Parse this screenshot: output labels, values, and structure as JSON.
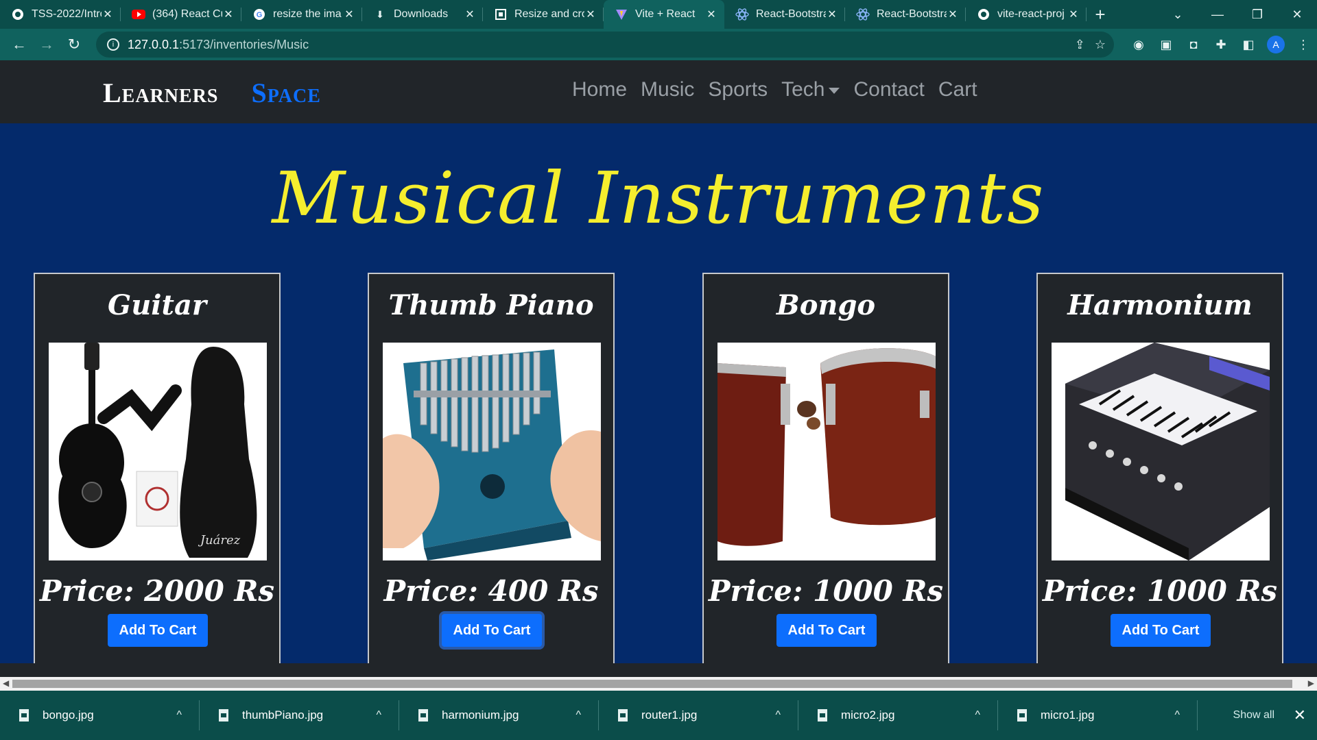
{
  "browser": {
    "tabs": [
      {
        "title": "TSS-2022/Intro",
        "icon": "github-icon"
      },
      {
        "title": "(364) React Cu",
        "icon": "youtube-icon"
      },
      {
        "title": "resize the ima",
        "icon": "google-icon"
      },
      {
        "title": "Downloads",
        "icon": "download-icon"
      },
      {
        "title": "Resize and cro",
        "icon": "crop-icon"
      },
      {
        "title": "Vite + React",
        "icon": "vite-icon",
        "active": true
      },
      {
        "title": "React-Bootstra",
        "icon": "react-icon"
      },
      {
        "title": "React-Bootstra",
        "icon": "react-icon"
      },
      {
        "title": "vite-react-proj",
        "icon": "github-icon"
      }
    ],
    "url_host": "127.0.0.1",
    "url_path": ":5173/inventories/Music",
    "profile_initial": "A"
  },
  "site": {
    "brand_first": "Learners",
    "brand_second": "Space",
    "nav": [
      "Home",
      "Music",
      "Sports",
      "Tech",
      "Contact",
      "Cart"
    ],
    "heading": "Musical Instruments",
    "products": [
      {
        "name": "Guitar",
        "price": "Price: 2000 Rs",
        "button": "Add To Cart",
        "image_caption": "Juárez"
      },
      {
        "name": "Thumb Piano",
        "price": "Price: 400 Rs",
        "button": "Add To Cart"
      },
      {
        "name": "Bongo",
        "price": "Price: 1000 Rs",
        "button": "Add To Cart"
      },
      {
        "name": "Harmonium",
        "price": "Price: 1000 Rs",
        "button": "Add To Cart"
      }
    ]
  },
  "downloads": {
    "items": [
      "bongo.jpg",
      "thumbPiano.jpg",
      "harmonium.jpg",
      "router1.jpg",
      "micro2.jpg",
      "micro1.jpg"
    ],
    "show_all": "Show all"
  },
  "colors": {
    "page_bg": "#042a6b",
    "heading": "#f5ee2e",
    "navbar_bg": "#212529",
    "primary": "#0d6efd"
  }
}
